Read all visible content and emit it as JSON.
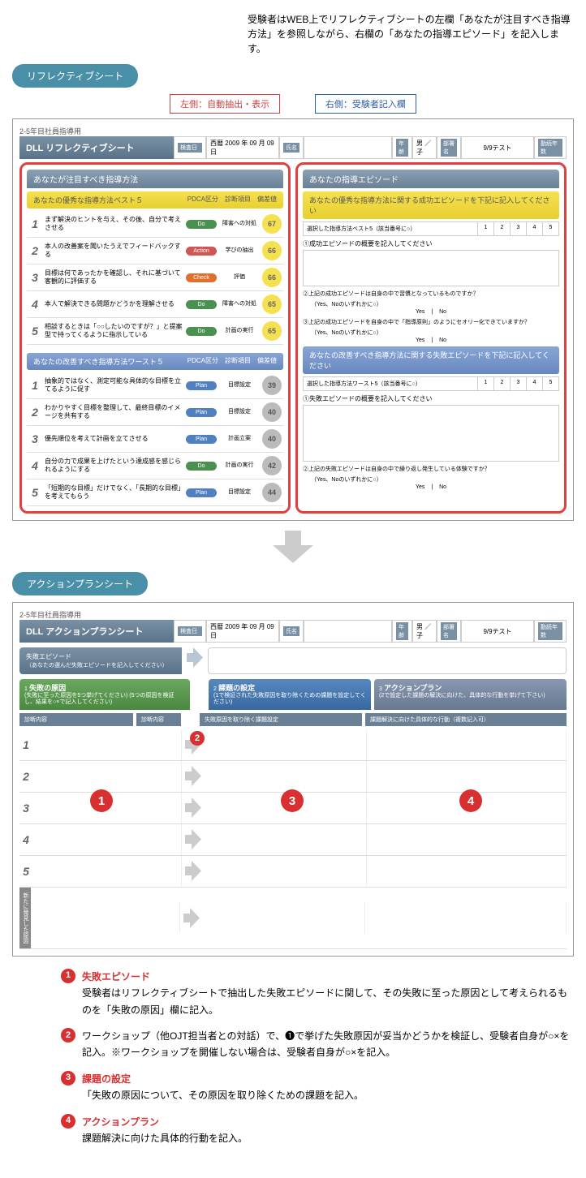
{
  "intro": "受験者はWEB上でリフレクティブシートの左欄「あなたが注目すべき指導方法」を参照しながら、右欄の「あなたの指導エピソード」を記入します。",
  "tab1": "リフレクティブシート",
  "tab2": "アクションプランシート",
  "callout_left": "左側：自動抽出・表示",
  "callout_right": "右側：受験者記入欄",
  "sheet1": {
    "pretitle": "2-5年目社員指導用",
    "title": "DLL リフレクティブシート",
    "meta": {
      "date_lbl": "検査日",
      "era": "西暦",
      "year": "2009",
      "month": "09",
      "day": "09",
      "name_lbl": "氏名",
      "age_lbl": "年齢",
      "gender": "男 ／ 子",
      "dept_lbl": "部署名",
      "dept": "9/9テスト",
      "tenure_lbl": "勤続年数"
    },
    "left_hdr": "あなたが注目すべき指導方法",
    "best5_hdr": "あなたの優秀な指導方法ベスト５",
    "hdr_pdca": "PDCA区分",
    "hdr_diag": "診断項目",
    "hdr_dev": "偏差値",
    "best5": [
      {
        "n": "1",
        "text": "まず解決のヒントを与え、その後、自分で考えさせる",
        "pdca": "Do",
        "cls": "pdca-do",
        "diag": "障害への対処",
        "score": "67"
      },
      {
        "n": "2",
        "text": "本人の改善案を聞いたうえでフィードバックする",
        "pdca": "Action",
        "cls": "pdca-action",
        "diag": "学びの抽出",
        "score": "66"
      },
      {
        "n": "3",
        "text": "目標は何であったかを確認し、それに基づいて客観的に評価する",
        "pdca": "Check",
        "cls": "pdca-check",
        "diag": "評価",
        "score": "66"
      },
      {
        "n": "4",
        "text": "本人で解決できる問題かどうかを理解させる",
        "pdca": "Do",
        "cls": "pdca-do",
        "diag": "障害への対処",
        "score": "65"
      },
      {
        "n": "5",
        "text": "相談するときは「○○したいのですが？」と提案型で持ってくるように指示している",
        "pdca": "Do",
        "cls": "pdca-do",
        "diag": "計画の実行",
        "score": "65"
      }
    ],
    "worst5_hdr": "あなたの改善すべき指導方法ワースト５",
    "worst5": [
      {
        "n": "1",
        "text": "抽象的ではなく、測定可能な具体的な目標を立てるように促す",
        "pdca": "Plan",
        "cls": "pdca-plan",
        "diag": "目標設定",
        "score": "39"
      },
      {
        "n": "2",
        "text": "わかりやすく目標を整理して、最終目標のイメージを共有する",
        "pdca": "Plan",
        "cls": "pdca-plan",
        "diag": "目標設定",
        "score": "40"
      },
      {
        "n": "3",
        "text": "優先順位を考えて計画を立てさせる",
        "pdca": "Plan",
        "cls": "pdca-plan",
        "diag": "計画立案",
        "score": "40"
      },
      {
        "n": "4",
        "text": "自分の力で成果を上げたという達成感を感じられるようにする",
        "pdca": "Do",
        "cls": "pdca-do",
        "diag": "計画の実行",
        "score": "42"
      },
      {
        "n": "5",
        "text": "「短期的な目標」だけでなく、「長期的な目標」を考えてもらう",
        "pdca": "Plan",
        "cls": "pdca-plan",
        "diag": "目標設定",
        "score": "44"
      }
    ],
    "right_hdr": "あなたの指導エピソード",
    "right_best_hdr": "あなたの優秀な指導方法に関する成功エピソードを下記に記入してください",
    "sel_best": "選択した指導方法ベスト5（該当番号に○）",
    "input_best": "①成功エピソードの概要を記入してください",
    "q_best_2": "②上記の成功エピソードは自身の中で習慣となっているものですか？",
    "q_best_3": "③上記の成功エピソードを自身の中で「指導原則」のようにセオリー化できていますか？",
    "yn_hint": "（Yes、Noのいずれかに○）",
    "yes": "Yes",
    "no": "No",
    "right_worst_hdr": "あなたの改善すべき指導方法に関する失敗エピソードを下記に記入してください",
    "sel_worst": "選択した指導方法ワースト5（該当番号に○）",
    "input_worst": "①失敗エピソードの概要を記入してください",
    "q_worst_2": "②上記の失敗エピソードは自身の中で繰り返し発生している体験ですか？"
  },
  "sheet2": {
    "pretitle": "2-5年目社員指導用",
    "title": "DLL アクションプランシート",
    "episode_lbl": "失敗エピソード",
    "episode_sub": "（あなたの選んだ失敗エピソードを記入してください）",
    "col1_t": "失敗の原因",
    "col1_s": "(失敗に至った原因を5つ挙げてください)\n(5つの原因を検証し、結果を○×で記入してください)",
    "col2_t": "課題の設定",
    "col2_s": "(1で検証された失敗原因を取り除くための課題を設定してください)",
    "col3_t": "アクションプラン",
    "col3_s": "(2で設定した課題の解決に向けた、具体的な行動を挙げて下さい)",
    "sub1a": "診断内容",
    "sub1b": "診断内容",
    "sub2": "失敗原因を取り除く課題設定",
    "sub3": "課題解決に向けた具体的な行動（複数記入可）",
    "rows": [
      "1",
      "2",
      "3",
      "4",
      "5"
    ],
    "new_cause": "新たに発見した原因"
  },
  "legend": [
    {
      "n": "❶",
      "title": "失敗エピソード",
      "body": "受験者はリフレクティブシートで抽出した失敗エピソードに関して、その失敗に至った原因として考えられるものを「失敗の原因」欄に記入。"
    },
    {
      "n": "❷",
      "title": "",
      "body": "ワークショップ（他OJT担当者との対話）で、❶で挙げた失敗原因が妥当かどうかを検証し、受験者自身が○×を記入。※ワークショップを開催しない場合は、受験者自身が○×を記入。"
    },
    {
      "n": "❸",
      "title": "課題の設定",
      "body": "「失敗の原因について、その原因を取り除くための課題を記入。"
    },
    {
      "n": "❹",
      "title": "アクションプラン",
      "body": "課題解決に向けた具体的行動を記入。"
    }
  ]
}
